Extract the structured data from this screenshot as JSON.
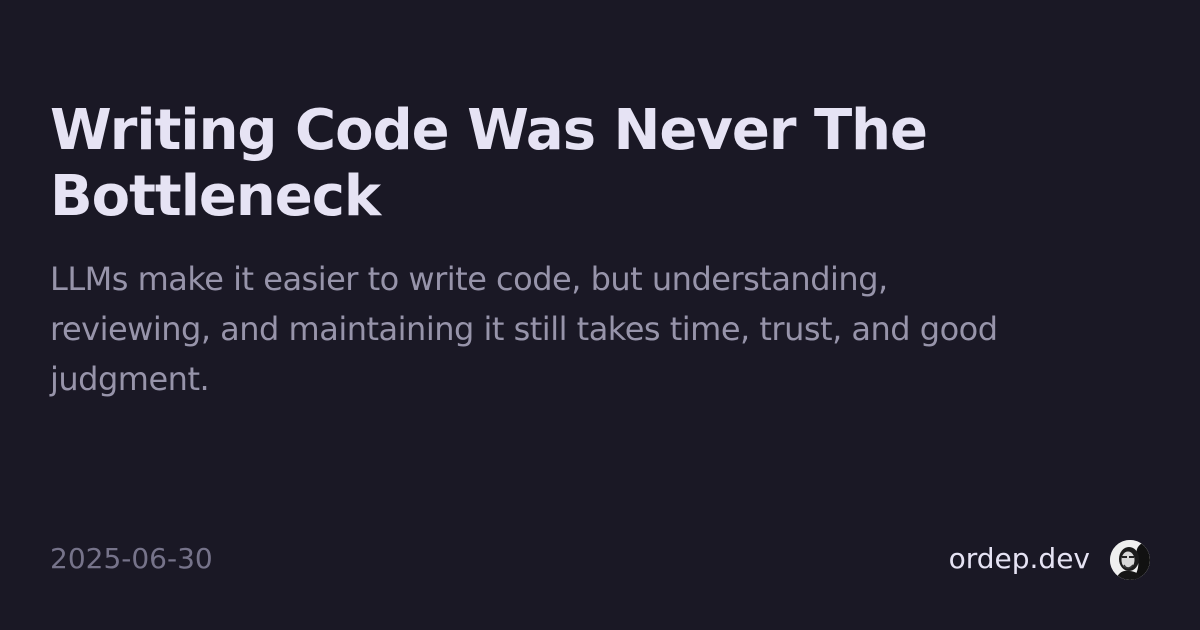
{
  "post": {
    "title": "Writing Code Was Never The Bottleneck",
    "description": "LLMs make it easier to write code, but understanding, reviewing, and maintaining it still takes time, trust, and good judgment.",
    "date": "2025-06-30"
  },
  "site": {
    "name": "ordep.dev",
    "avatar_icon": "author-avatar"
  },
  "colors": {
    "background": "#1a1825",
    "title": "#e6e3f4",
    "description": "#9794aa",
    "date": "#76738a"
  }
}
